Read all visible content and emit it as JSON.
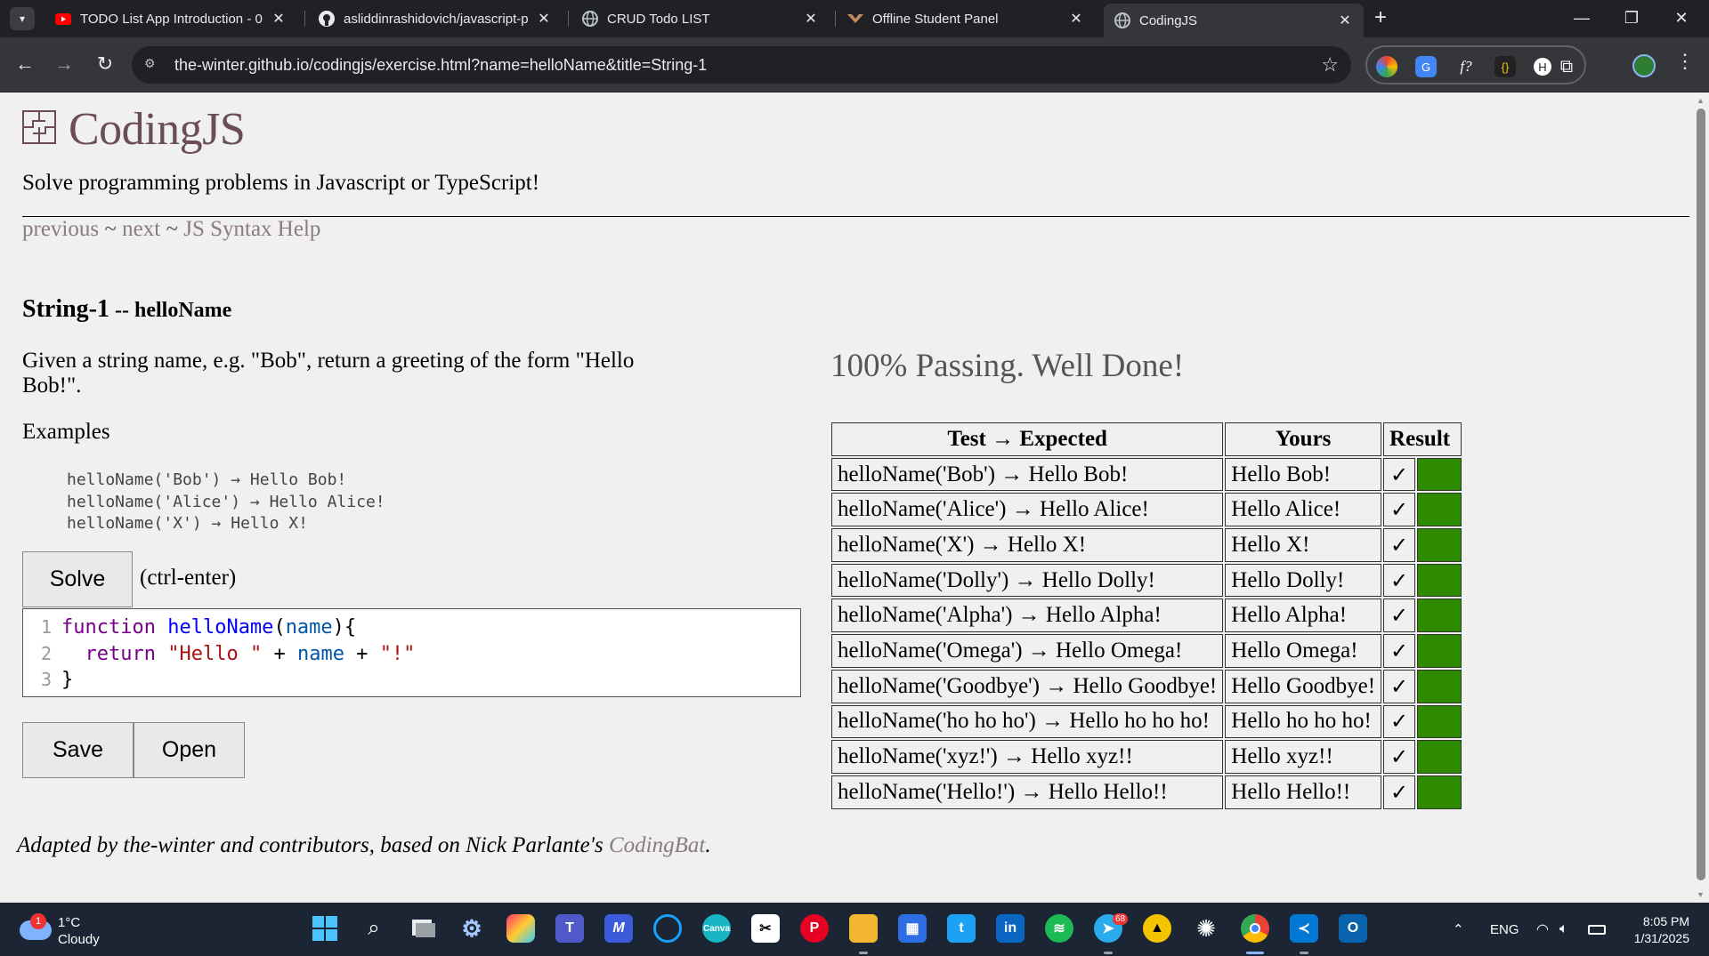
{
  "browser": {
    "tabs": [
      {
        "title": "TODO List App Introduction - 0",
        "favicon": "youtube-icon"
      },
      {
        "title": "asliddinrashidovich/javascript-p",
        "favicon": "github-icon"
      },
      {
        "title": "CRUD Todo LIST",
        "favicon": "globe-icon"
      },
      {
        "title": "Offline Student Panel",
        "favicon": "site-icon"
      },
      {
        "title": "CodingJS",
        "favicon": "globe-icon"
      }
    ],
    "url": "the-winter.github.io/codingjs/exercise.html?name=helloName&title=String-1",
    "extensions": [
      "color-picker-icon",
      "translate-icon",
      "formula-icon",
      "json-icon",
      "user-icon",
      "puzzle-icon"
    ]
  },
  "page": {
    "brand": "CodingJS",
    "tagline": "Solve programming problems in Javascript or TypeScript!",
    "nav": {
      "previous": "previous",
      "sep1": " ~ ",
      "next": "next",
      "sep2": " ~ ",
      "help": "JS Syntax Help"
    },
    "problem": {
      "group": "String-1",
      "separator": " -- ",
      "name": "helloName",
      "description": "Given a string name, e.g. \"Bob\", return a greeting of the form \"Hello Bob!\".",
      "examples_heading": "Examples",
      "examples": [
        "helloName('Bob') → Hello Bob!",
        "helloName('Alice') → Hello Alice!",
        "helloName('X') → Hello X!"
      ]
    },
    "solve_label": "Solve",
    "shortcut_hint": "(ctrl-enter)",
    "editor": {
      "line_numbers": [
        "1",
        "2",
        "3"
      ]
    },
    "save_label": "Save",
    "open_label": "Open",
    "status": "100% Passing. Well Done!",
    "results_table": {
      "headers": [
        "Test → Expected",
        "Yours",
        "Result"
      ],
      "rows": [
        {
          "test": "helloName('Bob') → Hello Bob!",
          "yours": "Hello Bob!",
          "result": "✓"
        },
        {
          "test": "helloName('Alice') → Hello Alice!",
          "yours": "Hello Alice!",
          "result": "✓"
        },
        {
          "test": "helloName('X') → Hello X!",
          "yours": "Hello X!",
          "result": "✓"
        },
        {
          "test": "helloName('Dolly') → Hello Dolly!",
          "yours": "Hello Dolly!",
          "result": "✓"
        },
        {
          "test": "helloName('Alpha') → Hello Alpha!",
          "yours": "Hello Alpha!",
          "result": "✓"
        },
        {
          "test": "helloName('Omega') → Hello Omega!",
          "yours": "Hello Omega!",
          "result": "✓"
        },
        {
          "test": "helloName('Goodbye') → Hello Goodbye!",
          "yours": "Hello Goodbye!",
          "result": "✓"
        },
        {
          "test": "helloName('ho ho ho') → Hello ho ho ho!",
          "yours": "Hello ho ho ho!",
          "result": "✓"
        },
        {
          "test": "helloName('xyz!') → Hello xyz!!",
          "yours": "Hello xyz!!",
          "result": "✓"
        },
        {
          "test": "helloName('Hello!') → Hello Hello!!",
          "yours": "Hello Hello!!",
          "result": "✓"
        }
      ],
      "pass_color": "#2e8b00"
    },
    "credit": {
      "prefix": "Adapted by the-winter and contributors, based on Nick Parlante's ",
      "link": "CodingBat",
      "suffix": "."
    }
  },
  "taskbar": {
    "weather": {
      "temp": "1°C",
      "condition": "Cloudy",
      "badge": "1"
    },
    "telegram_badge": "68",
    "language": "ENG",
    "time": "8:05 PM",
    "date": "1/31/2025"
  },
  "colors": {
    "brand": "#6b4d57",
    "link": "#8c7a82",
    "chrome_bg": "#202124",
    "taskbar_bg": "#1c2533"
  }
}
